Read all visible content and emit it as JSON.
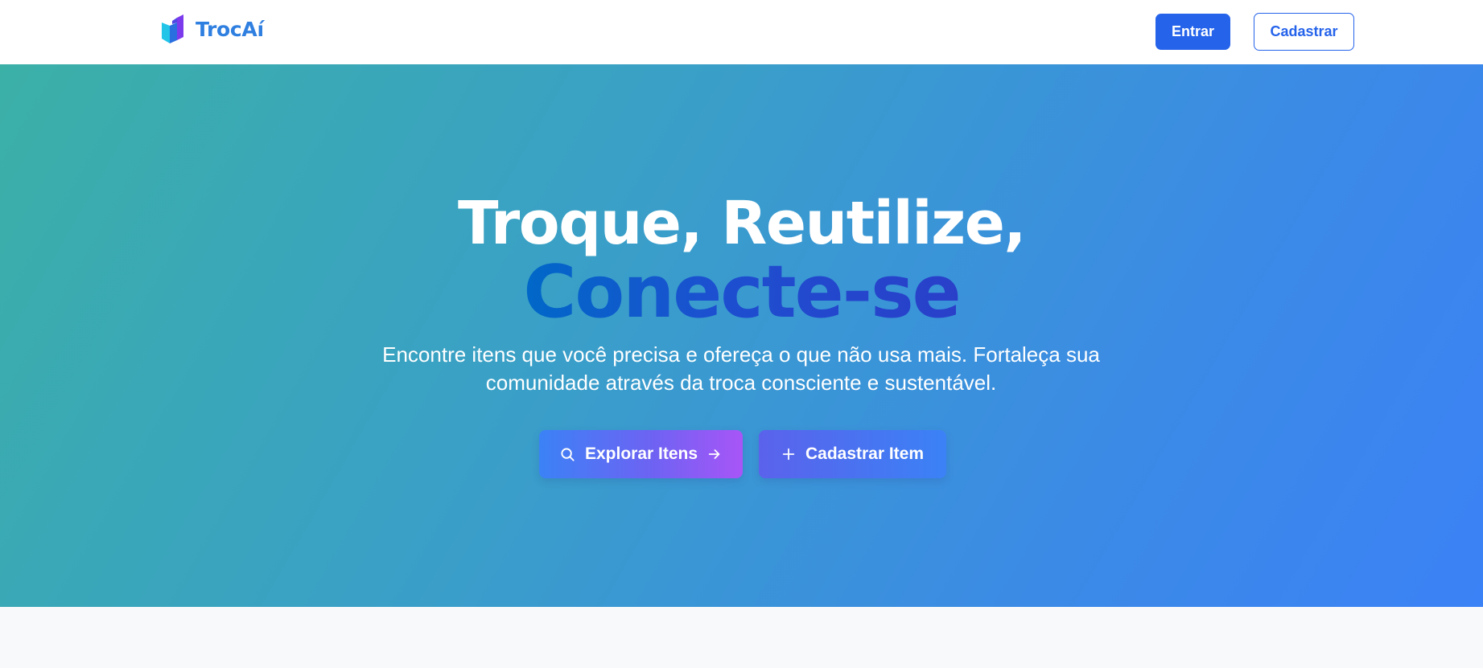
{
  "header": {
    "logo_text": "TrocAí",
    "login_label": "Entrar",
    "signup_label": "Cadastrar"
  },
  "hero": {
    "title_line1": "Troque, Reutilize,",
    "title_line2": "Conecte-se",
    "subtitle": "Encontre itens que você precisa e ofereça o que não usa mais. Fortaleça sua comunidade através da troca consciente e sustentável.",
    "explore_label": "Explorar Itens",
    "add_item_label": "Cadastrar Item"
  },
  "icons": {
    "logo": "book-cube-logo",
    "explore_left": "search-icon",
    "explore_right": "arrow-right-icon",
    "add_item": "plus-icon"
  },
  "colors": {
    "primary": "#2563eb",
    "hero_gradient_start": "#3bb0a7",
    "hero_gradient_end": "#3b82f6",
    "accent_purple": "#a855f7"
  }
}
